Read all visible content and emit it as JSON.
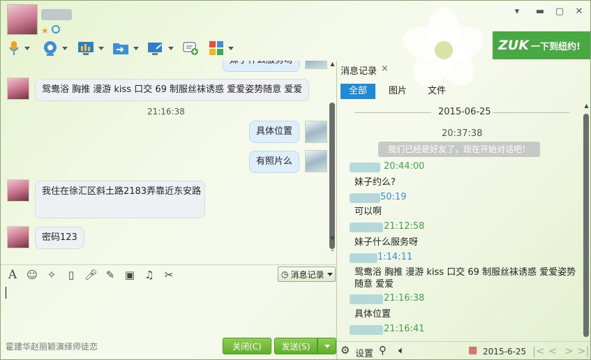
{
  "window": {
    "controls": {
      "pin": "▾",
      "minimize": "▬",
      "maximize": "▢",
      "close": "✕"
    }
  },
  "ad_banner": {
    "logo": "ZUK",
    "text": "一下到纽约!"
  },
  "chat": {
    "partial_top": "妹子什么服务呀",
    "messages": [
      {
        "from": "her",
        "text": "鸳鸯浴 胸推 漫游 kiss 口交  69 制服丝袜诱惑  爱爱姿势随意 爱爱"
      },
      {
        "time": "21:16:38"
      },
      {
        "from": "me",
        "text": "具体位置"
      },
      {
        "from": "me",
        "text": "有照片么"
      },
      {
        "from": "her",
        "text": "我住在徐汇区斜土路2183弄靠近东安路"
      },
      {
        "from": "her",
        "text": "密码123"
      }
    ]
  },
  "input_toolbar": {
    "font_icon": "A",
    "emoji_icon": "☺",
    "history_label": "消息记录"
  },
  "footer": {
    "ad_text": "霍建华赵丽颖演绎师徒恋",
    "close_label": "关闭(C)",
    "send_label": "发送(S)"
  },
  "history": {
    "tab_label": "消息记录",
    "close_icon": "×",
    "filters": [
      "全部",
      "图片",
      "文件"
    ],
    "date": "2015-06-25",
    "time_first": "20:37:38",
    "system_message": "我们已经是好友了，现在开始对话吧！",
    "entries": [
      {
        "time": "20:44:00",
        "color": "green"
      },
      {
        "text": "妹子约么?"
      },
      {
        "time": "50:19",
        "color": "blue"
      },
      {
        "text": "可以啊"
      },
      {
        "time": "21:12:58",
        "color": "green"
      },
      {
        "text": "妹子什么服务呀"
      },
      {
        "time": "1:14:11",
        "color": "blue"
      },
      {
        "text": "鸳鸯浴 胸推 漫游 kiss 口交  69 制服丝袜诱惑  爱爱姿势"
      },
      {
        "text": "随意 爱爱"
      },
      {
        "time": "21:16:38",
        "color": "green"
      },
      {
        "text": "具体位置"
      },
      {
        "time": "21:16:41",
        "color": "green"
      }
    ],
    "footer": {
      "settings_label": "设置",
      "date_value": "2015-6-25"
    }
  }
}
